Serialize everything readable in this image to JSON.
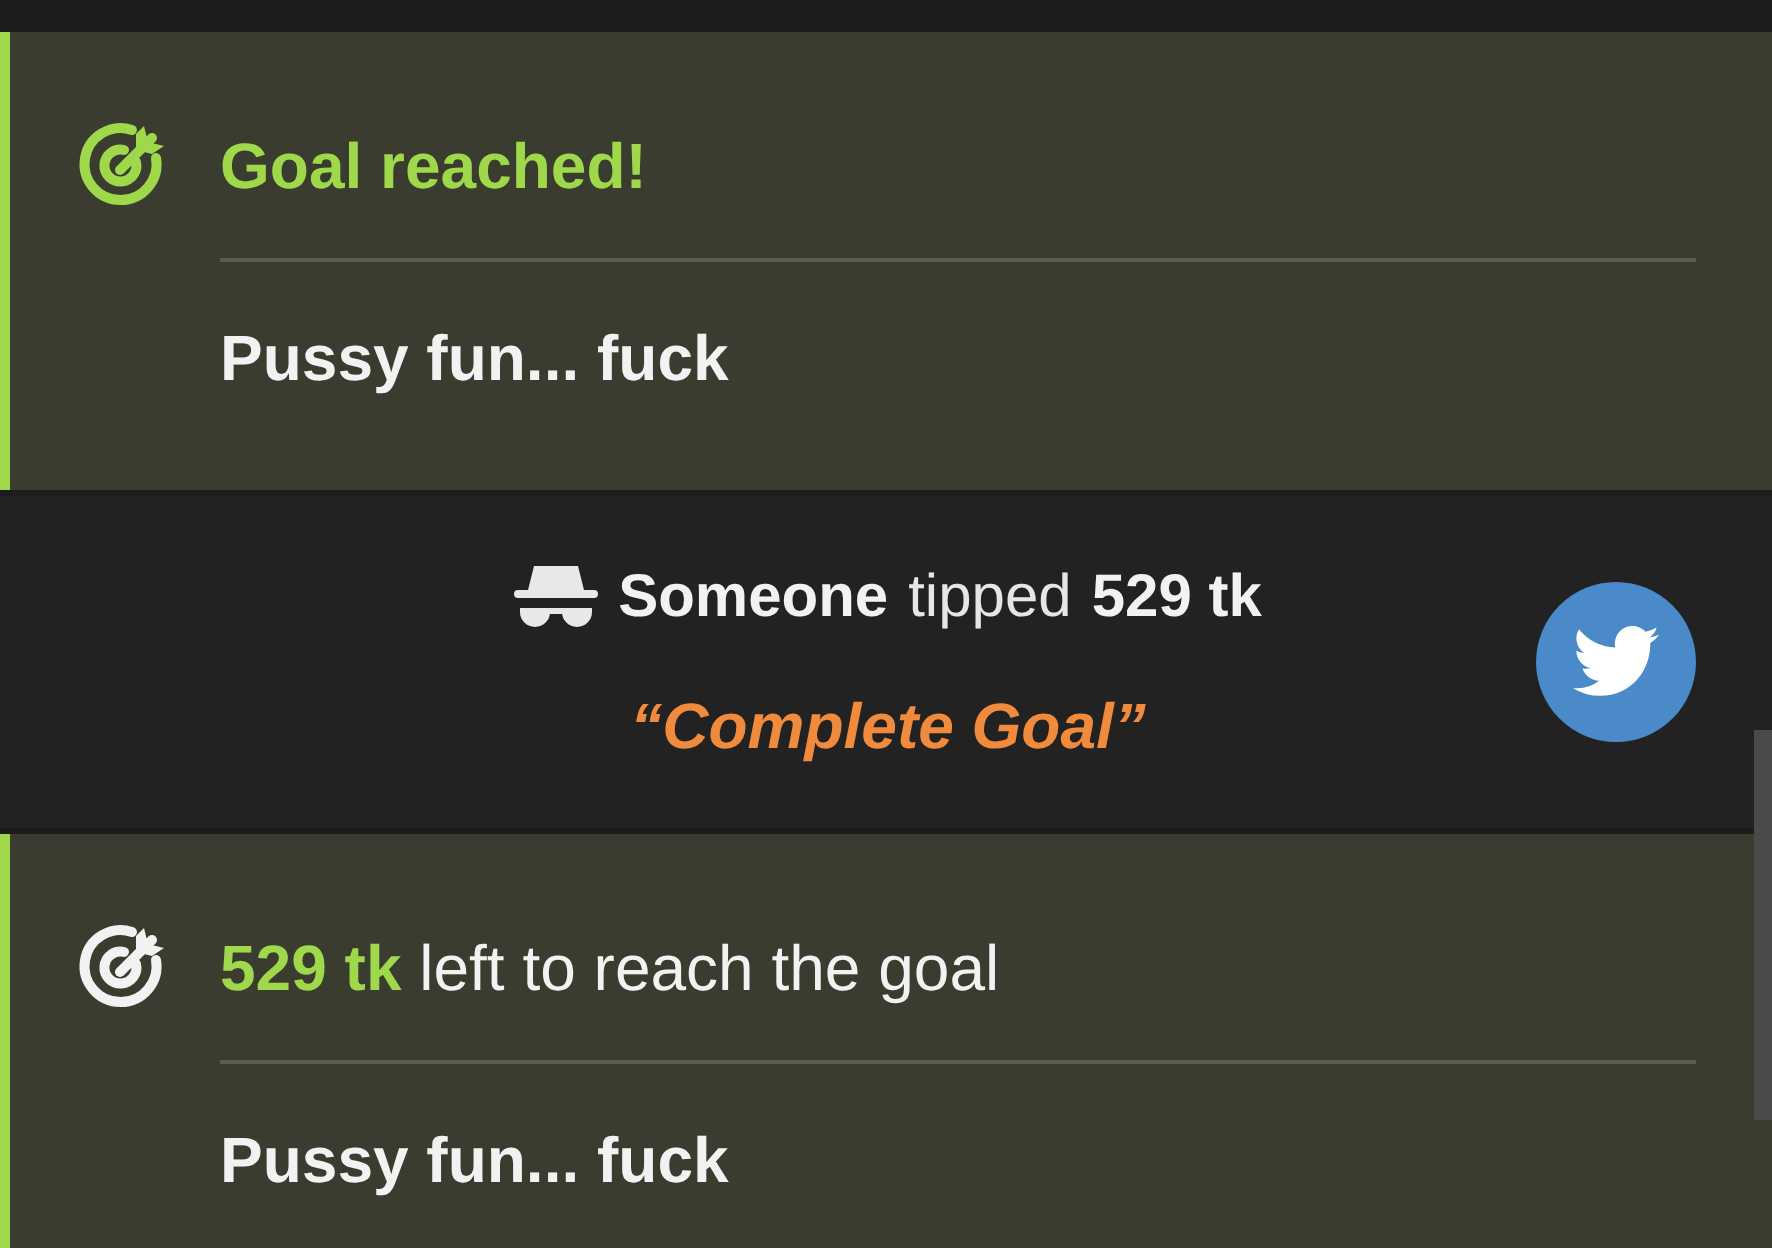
{
  "events": [
    {
      "kind": "goal_reached",
      "title": "Goal reached!",
      "goal": "Pussy fun... fuck"
    },
    {
      "kind": "tip",
      "user": "Someone",
      "verb": "tipped",
      "amount": "529 tk",
      "message": "“Complete Goal”"
    },
    {
      "kind": "goal_progress",
      "title": "**529 tk** left to reach the goal",
      "goal": "Pussy fun... fuck"
    }
  ]
}
